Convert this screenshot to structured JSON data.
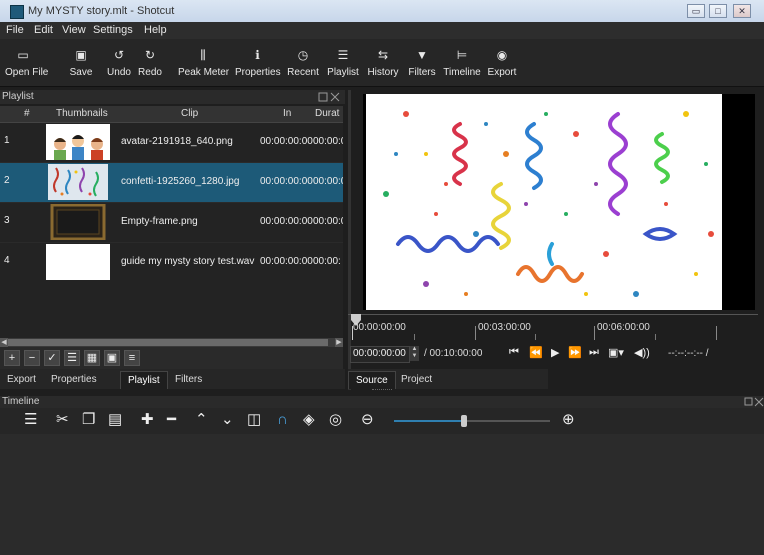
{
  "window": {
    "title": "My MYSTY story.mlt - Shotcut",
    "minimize": "▭",
    "maximize": "□",
    "close": "✕"
  },
  "menu": [
    "File",
    "Edit",
    "View",
    "Settings",
    "Help"
  ],
  "toolbar": [
    {
      "label": "Open File",
      "icon": "folder-icon"
    },
    {
      "label": "Save",
      "icon": "save-icon"
    },
    {
      "label": "Undo",
      "icon": "undo-icon"
    },
    {
      "label": "Redo",
      "icon": "redo-icon"
    },
    {
      "label": "Peak Meter",
      "icon": "peak-meter-icon"
    },
    {
      "label": "Properties",
      "icon": "info-icon"
    },
    {
      "label": "Recent",
      "icon": "clock-icon"
    },
    {
      "label": "Playlist",
      "icon": "list-icon"
    },
    {
      "label": "History",
      "icon": "history-icon"
    },
    {
      "label": "Filters",
      "icon": "filter-icon"
    },
    {
      "label": "Timeline",
      "icon": "timeline-icon"
    },
    {
      "label": "Export",
      "icon": "export-icon"
    }
  ],
  "playlist": {
    "panel_title": "Playlist",
    "columns": [
      "#",
      "Thumbnails",
      "Clip",
      "In",
      "Durat"
    ],
    "rows": [
      {
        "num": "1",
        "clip": "avatar-2191918_640.png",
        "in": "00:00:00:00",
        "dur": "00:00:0",
        "thumb": "avatars"
      },
      {
        "num": "2",
        "clip": "confetti-1925260_1280.jpg",
        "in": "00:00:00:00",
        "dur": "00:00:0",
        "thumb": "confetti",
        "selected": true
      },
      {
        "num": "3",
        "clip": "Empty-frame.png",
        "in": "00:00:00:00",
        "dur": "00:00:0",
        "thumb": "frame"
      },
      {
        "num": "4",
        "clip": "guide my mysty story  test.wav",
        "in": "00:00:00:00",
        "dur": "00:00:",
        "thumb": "blank"
      }
    ],
    "tabs": [
      "Export",
      "Properties",
      "Playlist",
      "Filters"
    ],
    "active_tab": "Playlist"
  },
  "player": {
    "ruler_labels": [
      "00:00:00:00",
      "00:03:00:00",
      "00:06:00:00"
    ],
    "position": "00:00:00:00",
    "duration": "/ 00:10:00:00",
    "in_out": "--:--:--:-- /",
    "tabs": [
      "Source",
      "Project"
    ],
    "active_tab": "Source"
  },
  "timeline": {
    "panel_title": "Timeline",
    "zoom_level": 0.45
  },
  "colors": {
    "selection": "#1d5a78",
    "accent": "#2f7fb0",
    "background": "#1e1e1e"
  }
}
